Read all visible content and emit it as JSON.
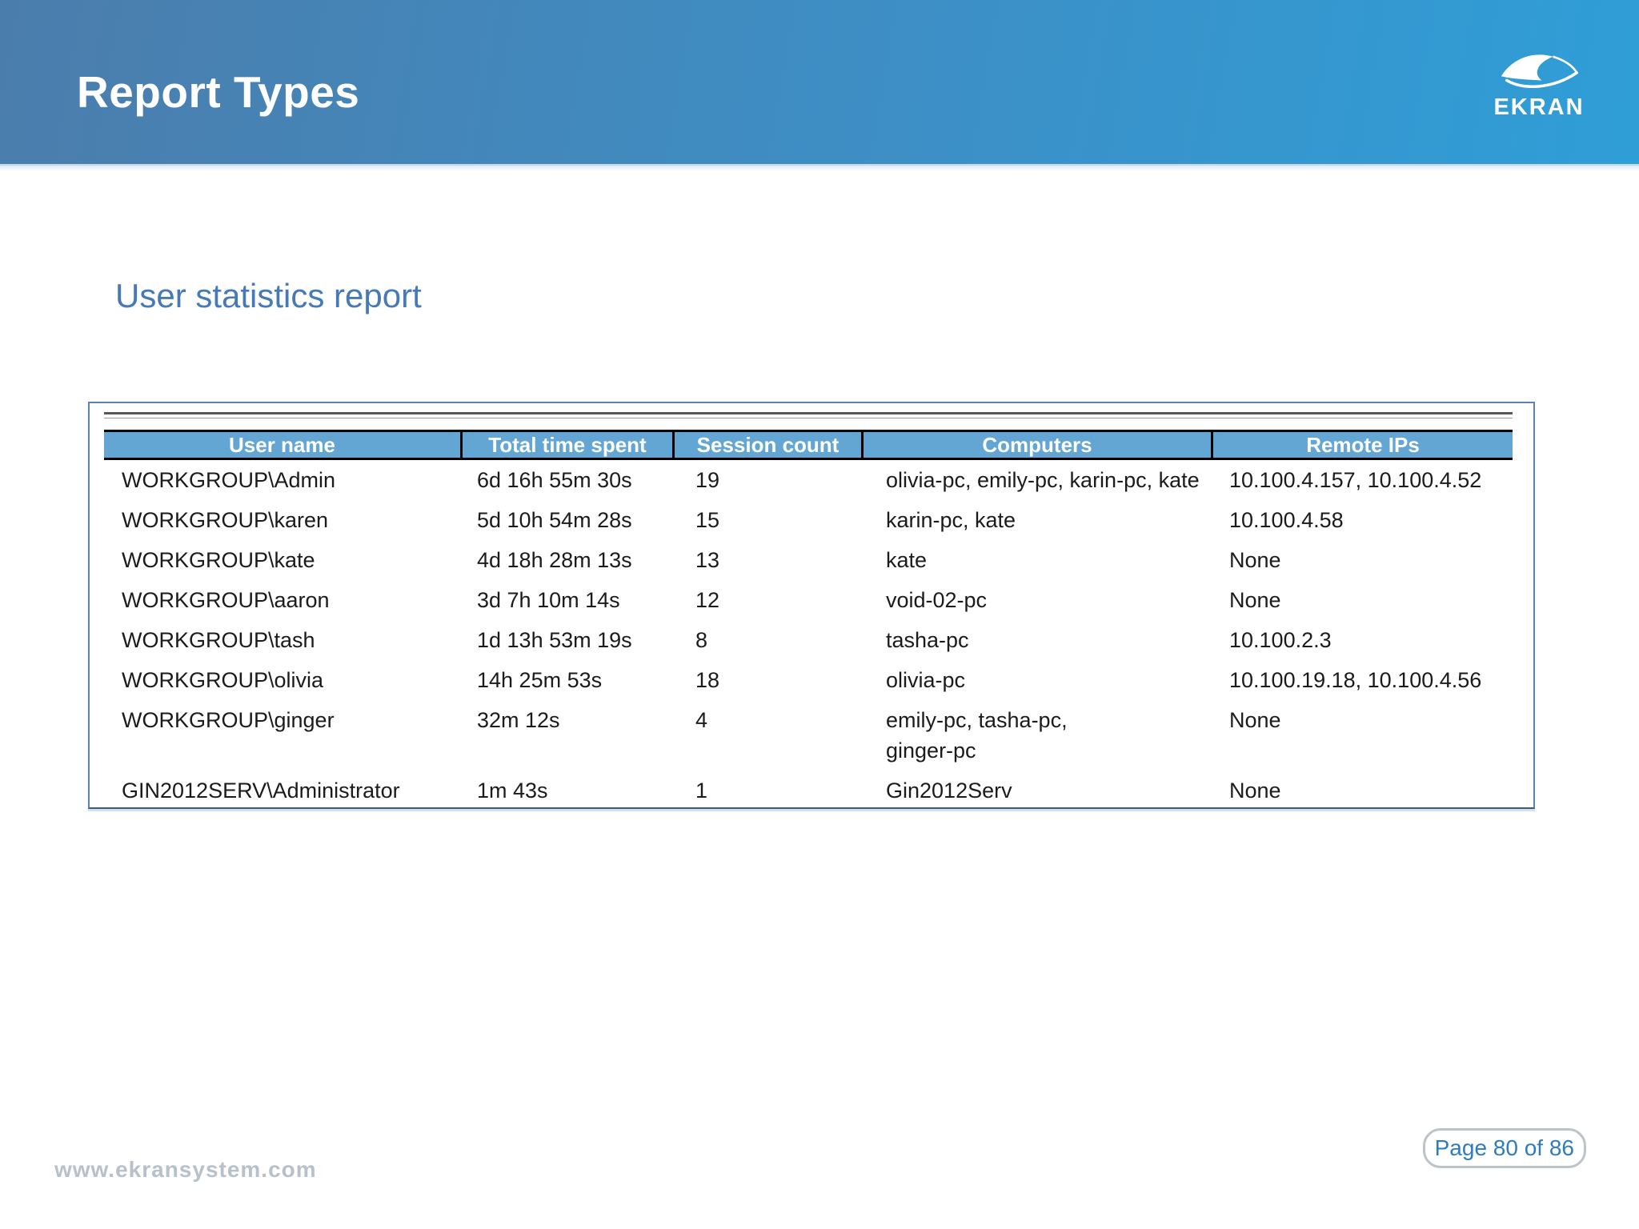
{
  "slide": {
    "title": "Report Types",
    "subtitle": "User statistics report",
    "logo": {
      "text": "EKRAN",
      "icon": "ekran-eye-icon"
    },
    "footer": {
      "website": "www.ekransystem.com",
      "page_label": "Page 80 of 86"
    }
  },
  "colors": {
    "header_gradient_start": "#4b7dac",
    "header_gradient_end": "#2f9ed7",
    "accent_blue": "#4679b8",
    "table_header_bg": "#63a6d4",
    "table_header_text": "#ffffff",
    "table_border_outer": "#5b82b8",
    "body_text": "#1b1b1b",
    "footer_text": "#b6c1ca",
    "page_text": "#2e7cc0"
  },
  "table": {
    "columns": [
      "User name",
      "Total time spent",
      "Session count",
      "Computers",
      "Remote IPs"
    ],
    "rows": [
      [
        "WORKGROUP\\Admin",
        "6d 16h 55m 30s",
        "19",
        "olivia-pc, emily-pc, karin-pc, kate",
        "10.100.4.157, 10.100.4.52"
      ],
      [
        "WORKGROUP\\karen",
        "5d 10h 54m 28s",
        "15",
        "karin-pc, kate",
        "10.100.4.58"
      ],
      [
        "WORKGROUP\\kate",
        "4d 18h 28m 13s",
        "13",
        "kate",
        "None"
      ],
      [
        "WORKGROUP\\aaron",
        "3d 7h 10m 14s",
        "12",
        "void-02-pc",
        "None"
      ],
      [
        "WORKGROUP\\tash",
        "1d 13h 53m 19s",
        "8",
        "tasha-pc",
        "10.100.2.3"
      ],
      [
        "WORKGROUP\\olivia",
        "14h 25m 53s",
        "18",
        "olivia-pc",
        "10.100.19.18, 10.100.4.56"
      ],
      [
        "WORKGROUP\\ginger",
        "32m 12s",
        "4",
        "emily-pc, tasha-pc,\nginger-pc",
        "None"
      ],
      [
        "GIN2012SERV\\Administrator",
        "1m 43s",
        "1",
        "Gin2012Serv",
        "None"
      ]
    ]
  }
}
